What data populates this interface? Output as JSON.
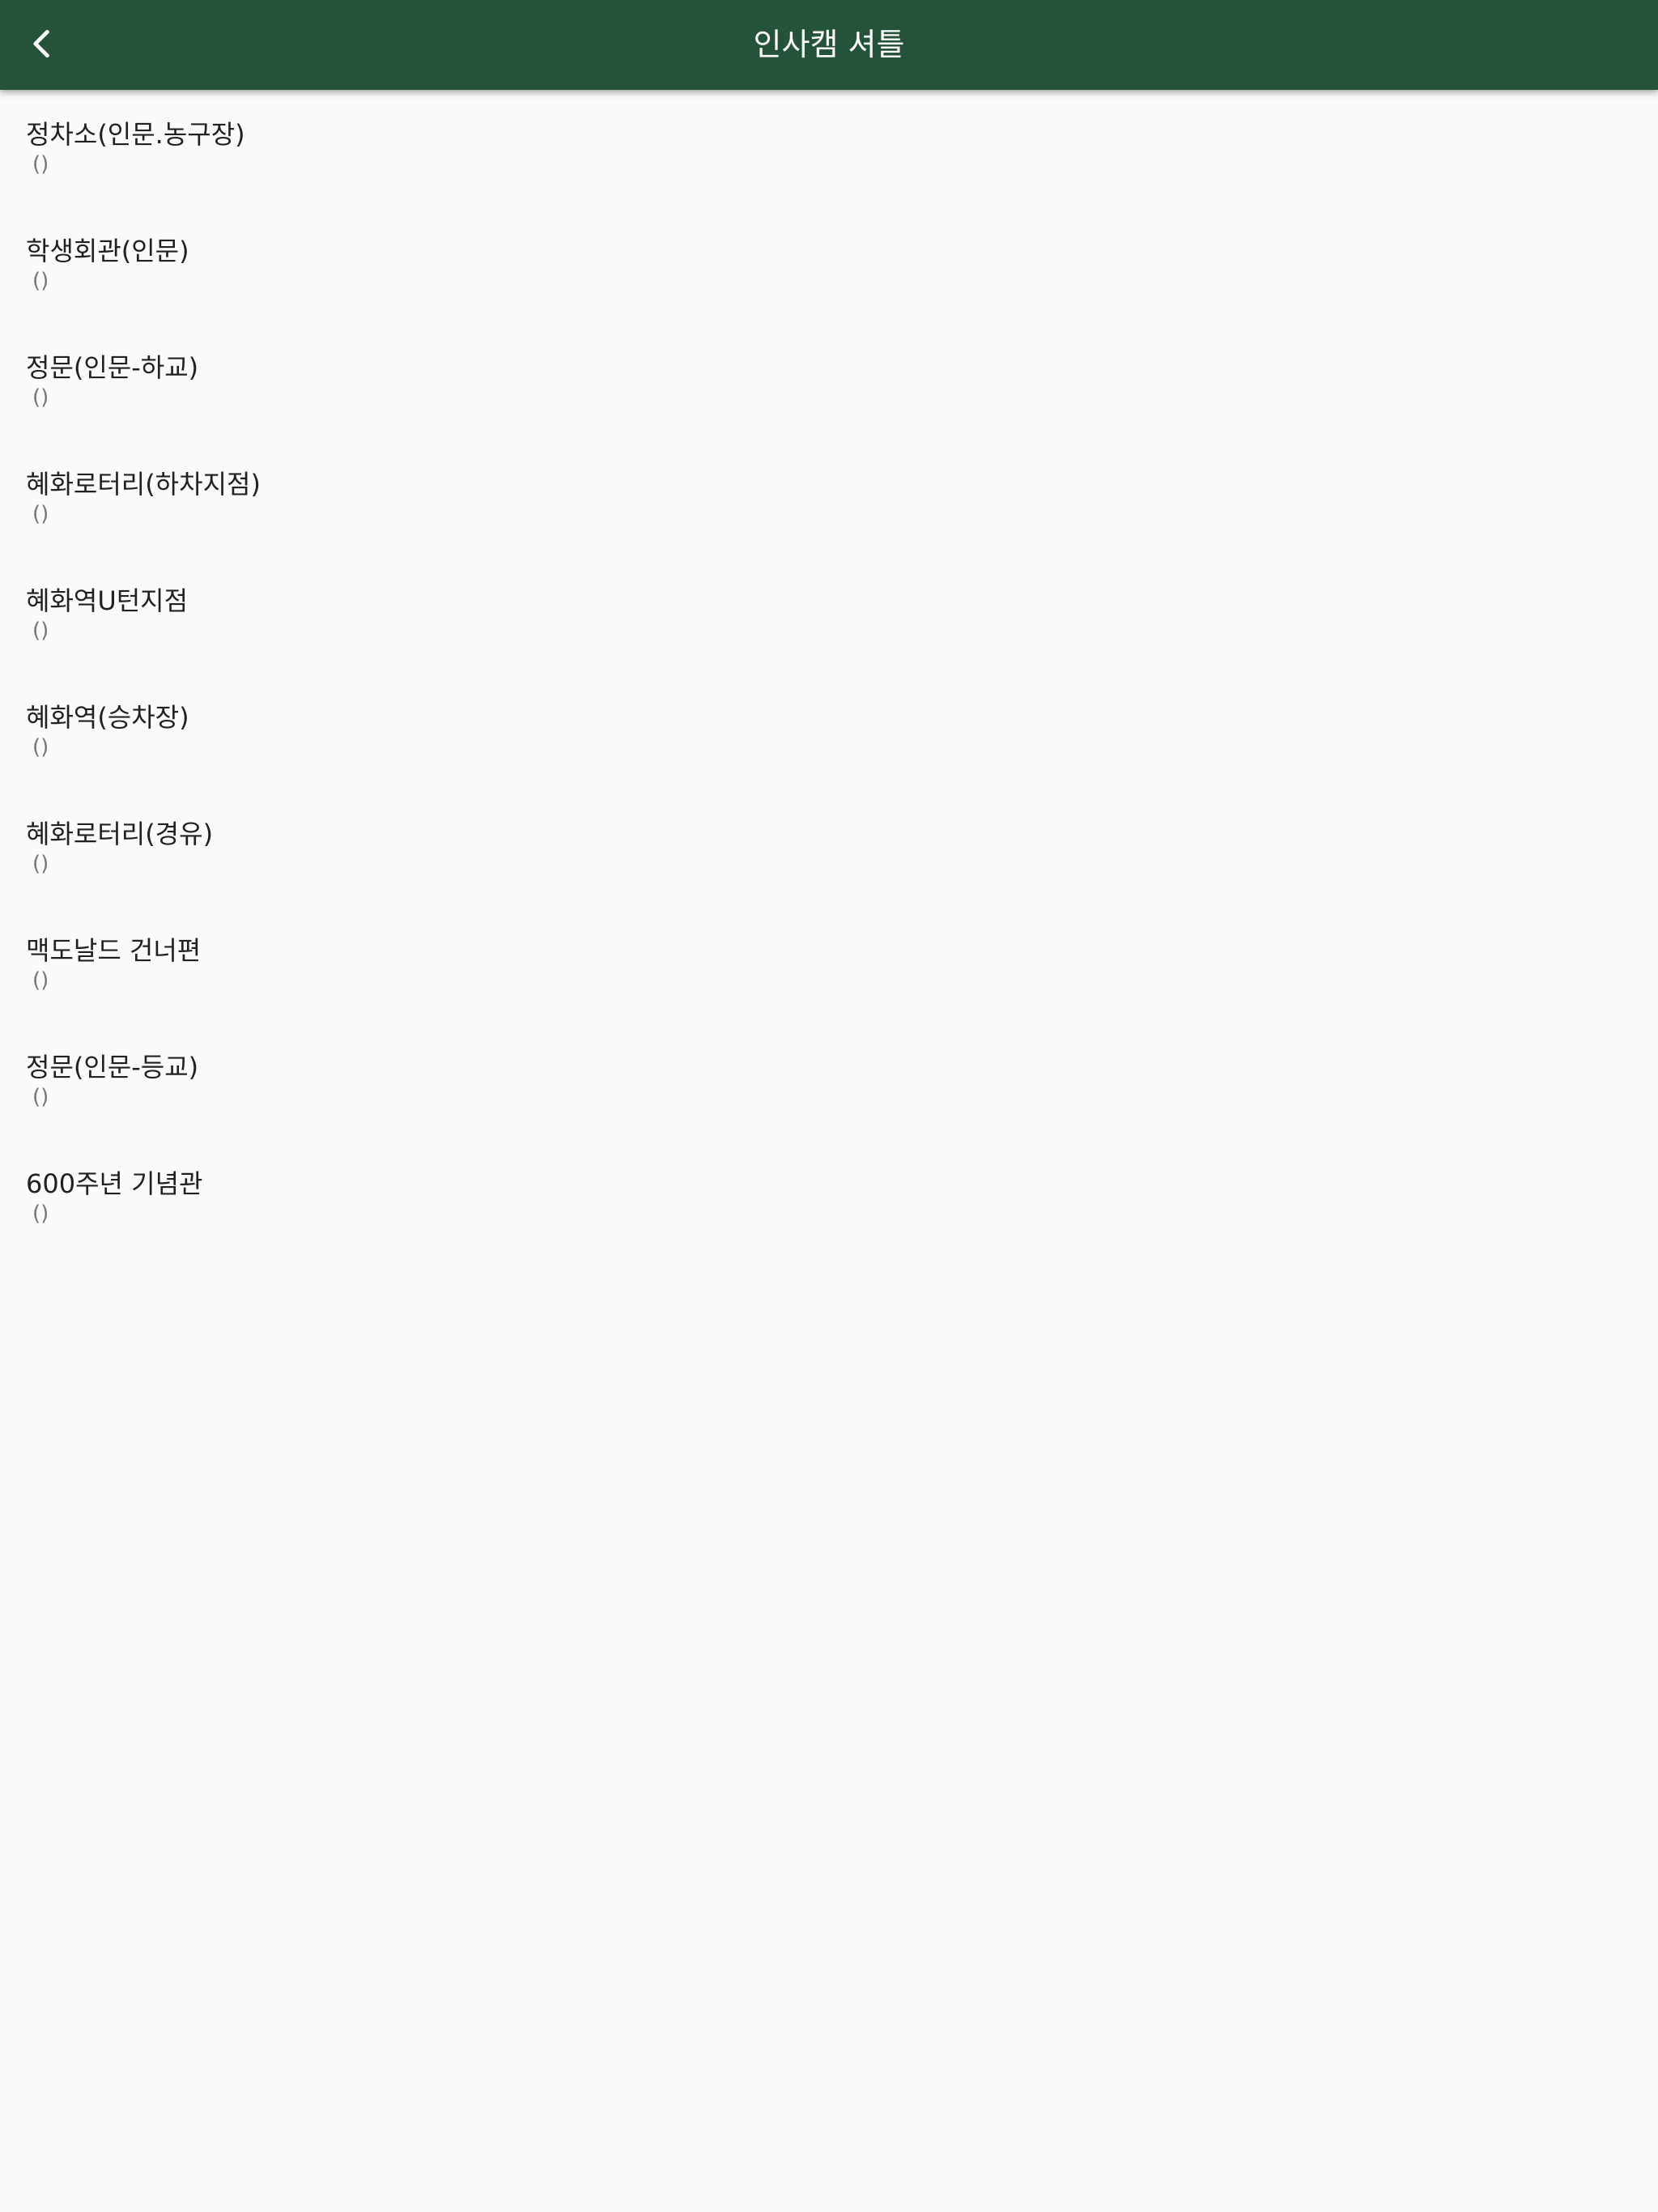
{
  "header": {
    "back_icon": "chevron-left-icon",
    "title": "인사캠 셔틀",
    "bar_color": "#245339"
  },
  "stops": [
    {
      "name": "정차소(인문.농구장)",
      "detail": "()"
    },
    {
      "name": "학생회관(인문)",
      "detail": "()"
    },
    {
      "name": "정문(인문-하교)",
      "detail": "()"
    },
    {
      "name": "혜화로터리(하차지점)",
      "detail": "()"
    },
    {
      "name": "혜화역U턴지점",
      "detail": "()"
    },
    {
      "name": "혜화역(승차장)",
      "detail": "()"
    },
    {
      "name": "혜화로터리(경유)",
      "detail": "()"
    },
    {
      "name": "맥도날드 건너편",
      "detail": "()"
    },
    {
      "name": "정문(인문-등교)",
      "detail": "()"
    },
    {
      "name": "600주년 기념관",
      "detail": "()"
    }
  ]
}
